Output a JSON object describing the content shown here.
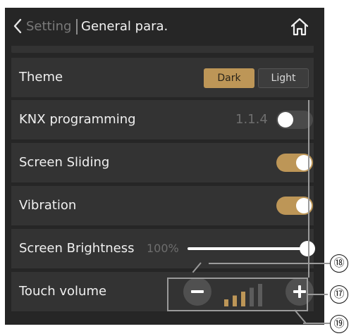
{
  "header": {
    "back_label": "Setting",
    "title": "General para."
  },
  "settings": {
    "theme": {
      "label": "Theme",
      "options": [
        "Dark",
        "Light"
      ],
      "selected": "Dark"
    },
    "knx_programming": {
      "label": "KNX programming",
      "address": "1.1.4",
      "enabled": false
    },
    "screen_sliding": {
      "label": "Screen Sliding",
      "enabled": true
    },
    "vibration": {
      "label": "Vibration",
      "enabled": true
    },
    "screen_brightness": {
      "label": "Screen Brightness",
      "value_text": "100%",
      "level": 1.0
    },
    "touch_volume": {
      "label": "Touch volume",
      "level_bars": 3,
      "total_bars": 5
    }
  },
  "callouts": [
    "⑱",
    "⑰",
    "⑲"
  ],
  "colors": {
    "accent": "#bd9657",
    "panel_bg": "#262626",
    "row_bg": "#333333"
  }
}
